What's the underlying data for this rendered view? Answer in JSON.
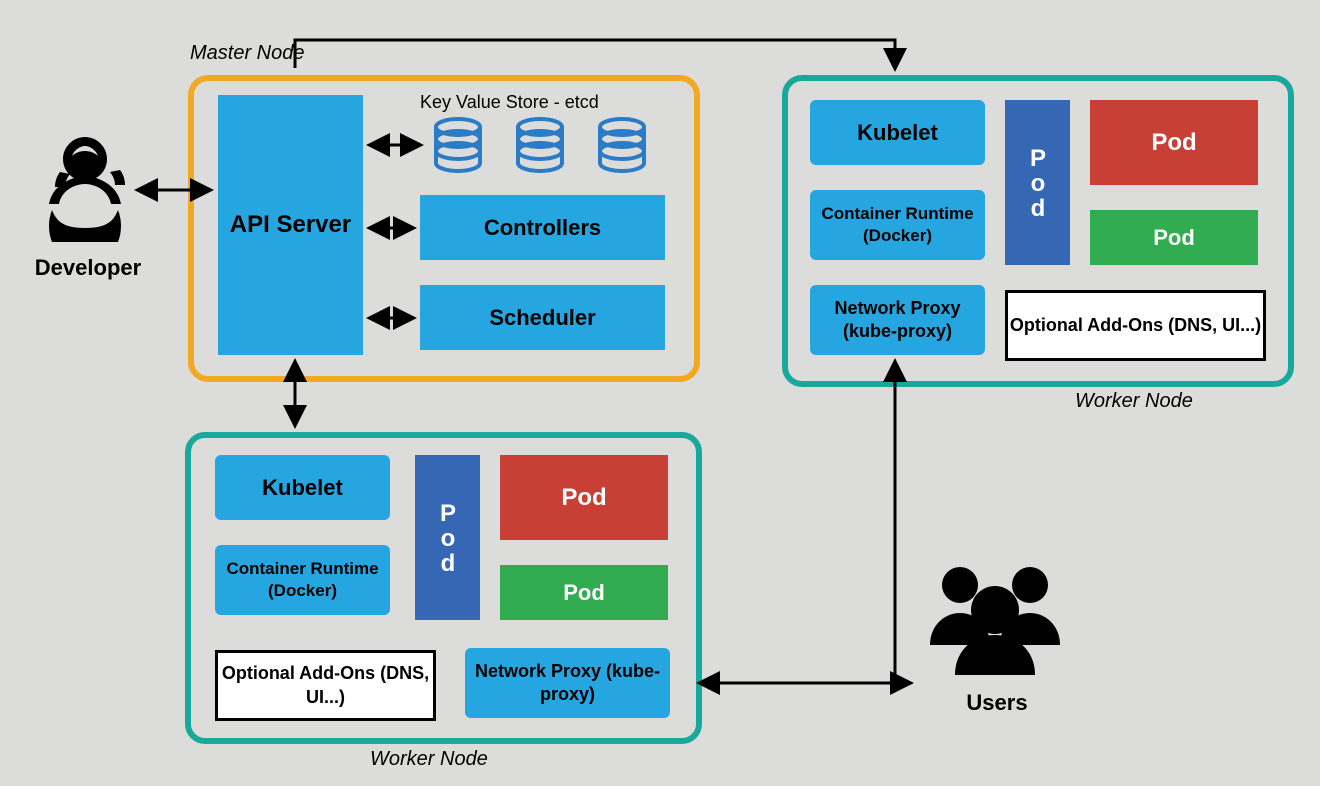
{
  "labels": {
    "developer": "Developer",
    "users": "Users",
    "master_node": "Master Node",
    "worker_node": "Worker Node",
    "etcd": "Key Value Store - etcd"
  },
  "master": {
    "api": "API Server",
    "controllers": "Controllers",
    "scheduler": "Scheduler"
  },
  "worker": {
    "kubelet": "Kubelet",
    "runtime": "Container Runtime (Docker)",
    "proxy": "Network Proxy (kube-proxy)",
    "addons": "Optional Add-Ons (DNS, UI...)",
    "pod": "Pod"
  }
}
